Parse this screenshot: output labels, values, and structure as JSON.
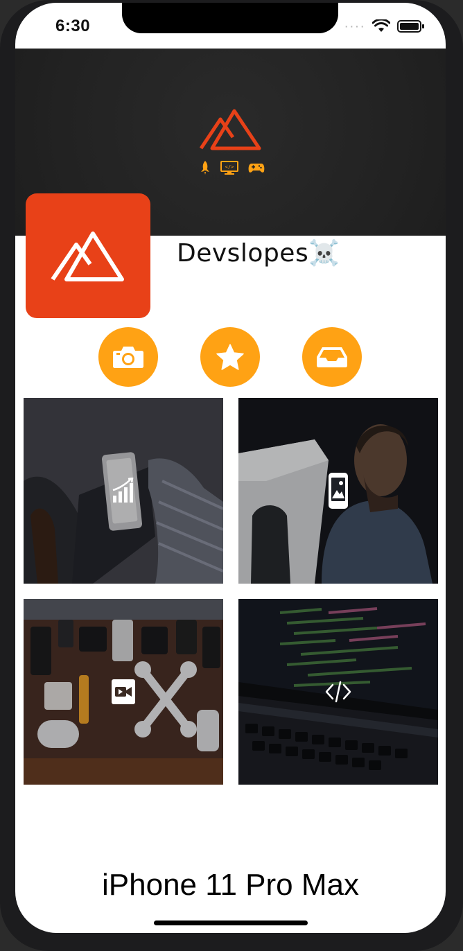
{
  "status_bar": {
    "time": "6:30",
    "signal_icon": "signal-dots-icon",
    "wifi_icon": "wifi-icon",
    "battery_icon": "battery-icon"
  },
  "header": {
    "logo_icon": "mountain-logo-icon",
    "category_icons": [
      "rocket-icon",
      "code-monitor-icon",
      "gamepad-icon"
    ]
  },
  "profile": {
    "name": "Devslopes☠️",
    "avatar_icon": "mountain-logo-icon"
  },
  "actions": [
    {
      "name": "camera",
      "icon": "camera-icon"
    },
    {
      "name": "favorites",
      "icon": "star-icon"
    },
    {
      "name": "inbox",
      "icon": "inbox-tray-icon"
    }
  ],
  "tiles": [
    {
      "name": "analytics-tile",
      "icon": "bar-chart-icon"
    },
    {
      "name": "photo-tile",
      "icon": "photo-icon"
    },
    {
      "name": "video-tile",
      "icon": "video-camera-icon"
    },
    {
      "name": "code-tile",
      "icon": "code-brackets-icon"
    }
  ],
  "device_caption": "iPhone 11 Pro Max",
  "colors": {
    "accent_orange": "#ffa214",
    "brand_red": "#e84118",
    "banner_dark": "#222222"
  }
}
